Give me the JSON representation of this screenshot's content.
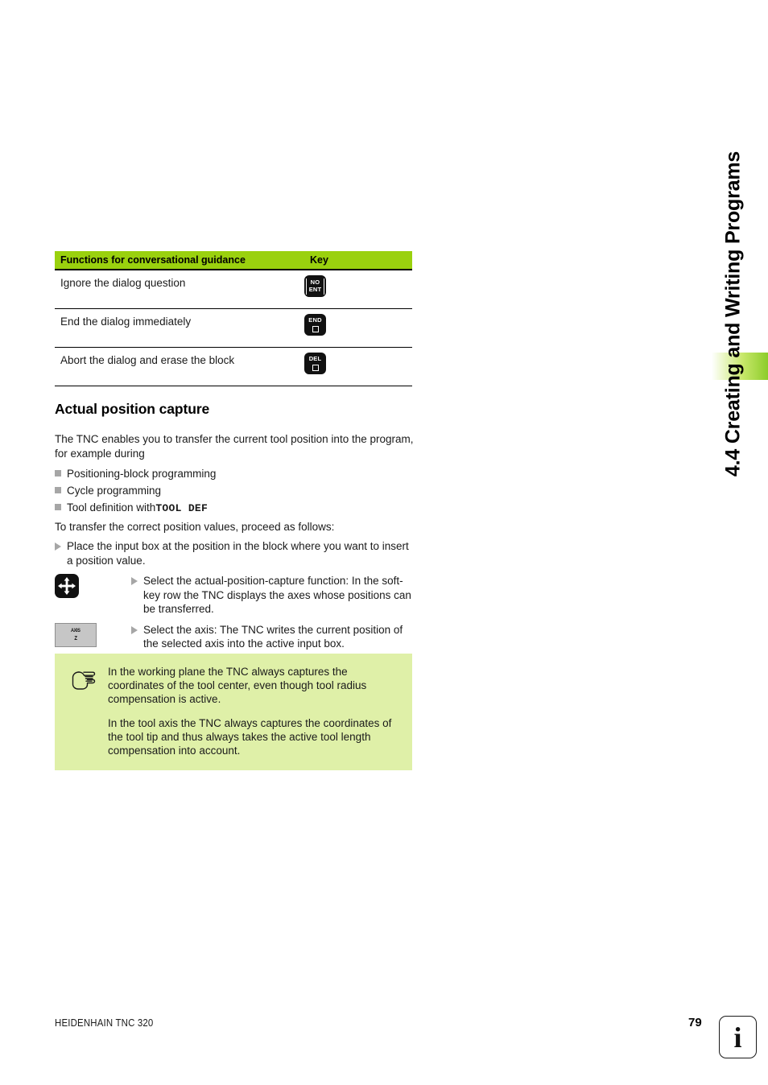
{
  "chapter": {
    "title": "4.4 Creating and Writing Programs",
    "tab_color": "#8ccc2a"
  },
  "table": {
    "header": {
      "description": "Functions for conversational guidance",
      "key": "Key",
      "background": "#9ad10e"
    },
    "rows": [
      {
        "description": "Ignore the dialog question",
        "key_icon": "no-ent-key",
        "key_lines": [
          "NO",
          "ENT"
        ]
      },
      {
        "description": "End the dialog immediately",
        "key_icon": "end-key",
        "key_lines": [
          "END"
        ]
      },
      {
        "description": "Abort the dialog and erase the block",
        "key_icon": "del-key",
        "key_lines": [
          "DEL"
        ]
      }
    ]
  },
  "section": {
    "heading": "Actual position capture",
    "intro": "The TNC enables you to transfer the current tool position into the program, for example during",
    "bullets": [
      {
        "text": "Positioning-block programming",
        "mono": ""
      },
      {
        "text": "Cycle programming",
        "mono": ""
      },
      {
        "text": "Tool definition with ",
        "mono": "TOOL DEF"
      }
    ],
    "transfer_intro": "To transfer the correct position values, proceed as follows:",
    "steps": [
      {
        "icon": "",
        "text": "Place the input box at the position in the block where you want to insert a position value."
      },
      {
        "icon": "actual-position-capture-key",
        "text": "Select the actual-position-capture function: In the soft-key row the TNC displays the axes whose positions can be transferred."
      },
      {
        "icon": "axis-z-softkey",
        "icon_label_line1": "AXIS",
        "icon_label_line2": "Z",
        "text": "Select the axis: The TNC writes the current position of the selected axis into the active input box."
      }
    ]
  },
  "note": {
    "icon": "pointing-hand-icon",
    "background": "#dff0a8",
    "paragraphs": [
      "In the working plane the TNC always captures the coordinates of the tool center, even though tool radius compensation is active.",
      "In the tool axis the TNC always captures the coordinates of the tool tip and thus always takes the active tool length compensation into account."
    ]
  },
  "footer": {
    "product": "HEIDENHAIN TNC 320",
    "page_number": "79",
    "info_glyph": "i"
  }
}
